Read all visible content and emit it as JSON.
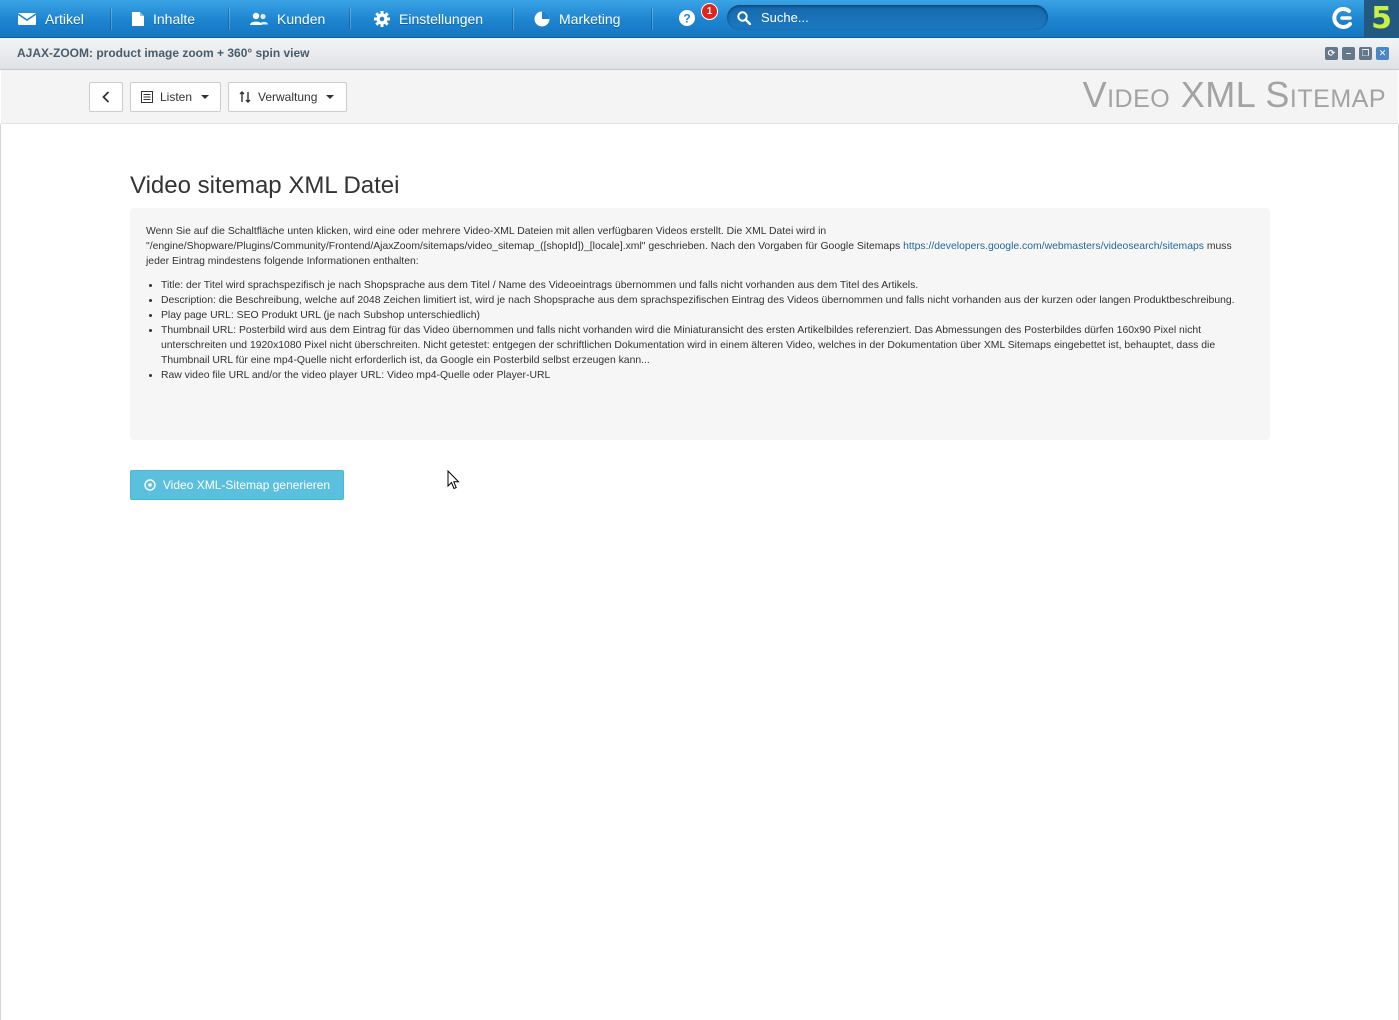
{
  "nav": {
    "items": [
      {
        "label": "Artikel",
        "icon": "envelope-icon"
      },
      {
        "label": "Inhalte",
        "icon": "document-icon"
      },
      {
        "label": "Kunden",
        "icon": "users-icon"
      },
      {
        "label": "Einstellungen",
        "icon": "gear-icon"
      },
      {
        "label": "Marketing",
        "icon": "pie-chart-icon"
      }
    ],
    "notification_count": "1",
    "search_placeholder": "Suche..."
  },
  "window": {
    "title": "AJAX-ZOOM: product image zoom + 360° spin view"
  },
  "toolbar": {
    "lists_label": "Listen",
    "management_label": "Verwaltung",
    "page_heading": "Video XML Sitemap"
  },
  "content": {
    "title": "Video sitemap XML Datei",
    "intro_part1": "Wenn Sie auf die Schaltfläche unten klicken, wird eine oder mehrere Video-XML Dateien mit allen verfügbaren Videos erstellt. Die XML Datei wird in \"/engine/Shopware/Plugins/Community/Frontend/AjaxZoom/sitemaps/video_sitemap_([shopId])_[locale].xml\" geschrieben. Nach den Vorgaben für Google Sitemaps ",
    "intro_link": "https://developers.google.com/webmasters/videosearch/sitemaps",
    "intro_part2": " muss jeder Eintrag mindestens folgende Informationen enthalten:",
    "requirements": [
      "Title: der Titel wird sprachspezifisch je nach Shopsprache aus dem Titel / Name des Videoeintrags übernommen und falls nicht vorhanden aus dem Titel des Artikels.",
      "Description: die Beschreibung, welche auf 2048 Zeichen limitiert ist, wird je nach Shopsprache aus dem sprachspezifischen Eintrag des Videos übernommen und falls nicht vorhanden aus der kurzen oder langen Produktbeschreibung.",
      "Play page URL: SEO Produkt URL (je nach Subshop unterschiedlich)",
      "Thumbnail URL: Posterbild wird aus dem Eintrag für das Video übernommen und falls nicht vorhanden wird die Miniaturansicht des ersten Artikelbildes referenziert. Das Abmessungen des Posterbildes dürfen 160x90 Pixel nicht unterschreiten und 1920x1080 Pixel nicht überschreiten. Nicht getestet: entgegen der schriftlichen Dokumentation wird in einem älteren Video, welches in der Dokumentation über XML Sitemaps eingebettet ist, behauptet, dass die Thumbnail URL für eine mp4-Quelle nicht erforderlich ist, da Google ein Posterbild selbst erzeugen kann...",
      "Raw video file URL and/or the video player URL: Video mp4-Quelle oder Player-URL"
    ],
    "generate_button": "Video XML-Sitemap generieren"
  },
  "colors": {
    "nav_blue": "#1d84cf",
    "accent_button": "#5bc0de",
    "badge_red": "#e2231a",
    "logo_green": "#c9f042"
  }
}
